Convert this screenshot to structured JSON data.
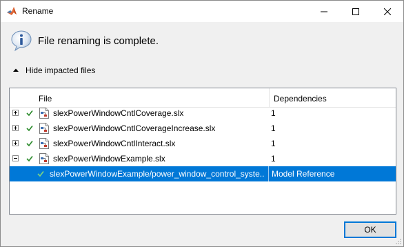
{
  "window": {
    "title": "Rename",
    "icons": {
      "app": "matlab-logo-icon",
      "minimize": "minimize-icon",
      "maximize": "maximize-icon",
      "close": "close-icon"
    }
  },
  "message": {
    "icon": "info-icon",
    "text": "File renaming is complete."
  },
  "toggle": {
    "icon": "collapse-triangle-icon",
    "label": "Hide impacted files"
  },
  "table": {
    "headers": {
      "file": "File",
      "dependencies": "Dependencies"
    },
    "rows": [
      {
        "expander": "plus",
        "file": "slexPowerWindowCntlCoverage.slx",
        "dependencies": "1",
        "selected": false
      },
      {
        "expander": "plus",
        "file": "slexPowerWindowCntlCoverageIncrease.slx",
        "dependencies": "1",
        "selected": false
      },
      {
        "expander": "plus",
        "file": "slexPowerWindowCntlInteract.slx",
        "dependencies": "1",
        "selected": false
      },
      {
        "expander": "minus",
        "file": "slexPowerWindowExample.slx",
        "dependencies": "1",
        "selected": false
      },
      {
        "expander": "none",
        "file": "slexPowerWindowExample/power_window_control_syste...",
        "dependencies": "Model Reference",
        "selected": true
      }
    ]
  },
  "buttons": {
    "ok": "OK"
  },
  "colors": {
    "selection": "#0078d7",
    "check": "#2a8a2a",
    "dialog_bg": "#f0f0f0"
  }
}
